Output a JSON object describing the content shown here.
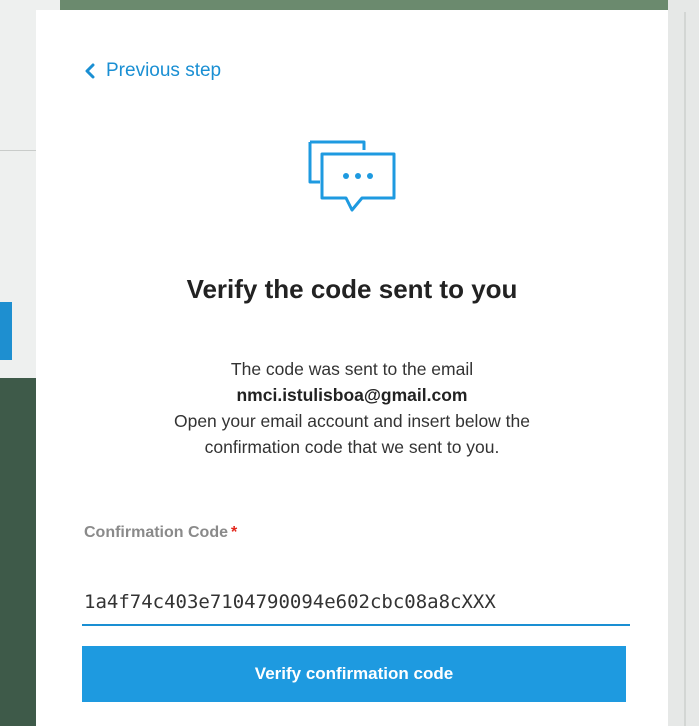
{
  "modal": {
    "back_link": "Previous step",
    "icon": "chat-bubbles-icon",
    "title": "Verify the code sent to you",
    "description": {
      "line1": "The code was sent to the email",
      "email": "nmci.istulisboa@gmail.com",
      "line3": "Open your email account and insert below the",
      "line4": "confirmation code that we sent to you."
    },
    "field": {
      "label": "Confirmation Code",
      "required_mark": "*",
      "value": "1a4f74c403e7104790094e602cbc08a8cXXX"
    },
    "verify_button": "Verify confirmation code"
  },
  "colors": {
    "accent": "#1a8fd3",
    "button": "#1e9ae0",
    "required": "#e3261b"
  }
}
